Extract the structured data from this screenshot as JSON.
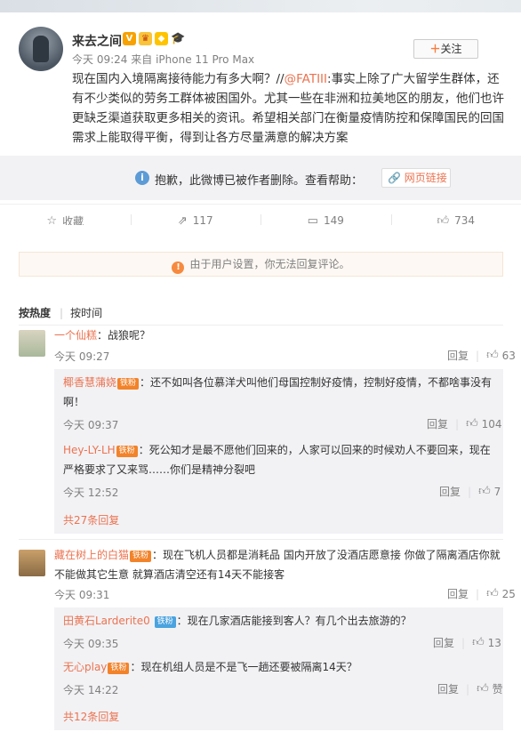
{
  "post": {
    "author": "来去之间",
    "follow_label": "+关注",
    "time": "今天 09:24",
    "source_prefix": "来自",
    "source": "iPhone 11 Pro Max",
    "body_before": "现在国内入境隔离接待能力有多大啊？//",
    "mention": "@FATIII",
    "body_after": ":事实上除了广大留学生群体，还有不少类似的劳务工群体被困国外。尤其一些在非洲和拉美地区的朋友，他们也许更缺乏渠道获取更多相关的资讯。希望相关部门在衡量疫情防控和保障国民的回国需求上能取得平衡，得到让各方尽量满意的解决方案"
  },
  "deleted": {
    "message": "抱歉，此微博已被作者删除。查看帮助：",
    "link_label": "网页链接"
  },
  "actions": {
    "favorite": "收藏",
    "repost": "117",
    "comment": "149",
    "like": "734"
  },
  "notice": "由于用户设置，你无法回复评论。",
  "sort": {
    "hot": "按热度",
    "time": "按时间"
  },
  "labels": {
    "reply": "回复"
  },
  "comments": [
    {
      "user": "一个仙糕",
      "text": "：战狼呢？",
      "time": "今天 09:27",
      "likes": "63",
      "replies": [
        {
          "user": "椰香慧蒲娆",
          "fan": "铁粉",
          "text": "：还不如叫各位慕洋犬叫他们母国控制好疫情，控制好疫情，不都啥事没有啊！",
          "time": "今天 09:37",
          "likes": "104"
        },
        {
          "user": "Hey-LY-LH",
          "fan": "铁粉",
          "text": "：死公知才是最不愿他们回来的，人家可以回来的时候劝人不要回来，现在严格要求了又来骂……你们是精神分裂吧",
          "time": "今天 12:52",
          "likes": "7"
        }
      ],
      "more": "共27条回复"
    },
    {
      "user": "藏在树上的白猫",
      "fan": "铁粉",
      "text": "：现在飞机人员都是消耗品 国内开放了没酒店愿意接 你做了隔离酒店你就不能做其它生意 就算酒店清空还有14天不能接客",
      "time": "今天 09:31",
      "likes": "25",
      "replies": [
        {
          "user": "田黄石Larderite0",
          "fan": "铁粉",
          "text": "：现在几家酒店能接到客人？有几个出去旅游的？",
          "time": "今天 09:35",
          "likes": "13"
        },
        {
          "user": "无心play",
          "fan": "铁粉",
          "text": "：现在机组人员是不是飞一趟还要被隔离14天？",
          "time": "今天 14:22",
          "likes": "赞"
        }
      ],
      "more": "共12条回复"
    }
  ],
  "colors": {
    "link": "#eb7350",
    "muted": "#808080",
    "gray_bg": "#f2f2f5",
    "notice_bg": "#fdf8f3"
  },
  "icons": [
    "info-icon",
    "link-icon",
    "star-icon",
    "repost-icon",
    "comment-icon",
    "thumb-up-icon",
    "warning-icon"
  ]
}
